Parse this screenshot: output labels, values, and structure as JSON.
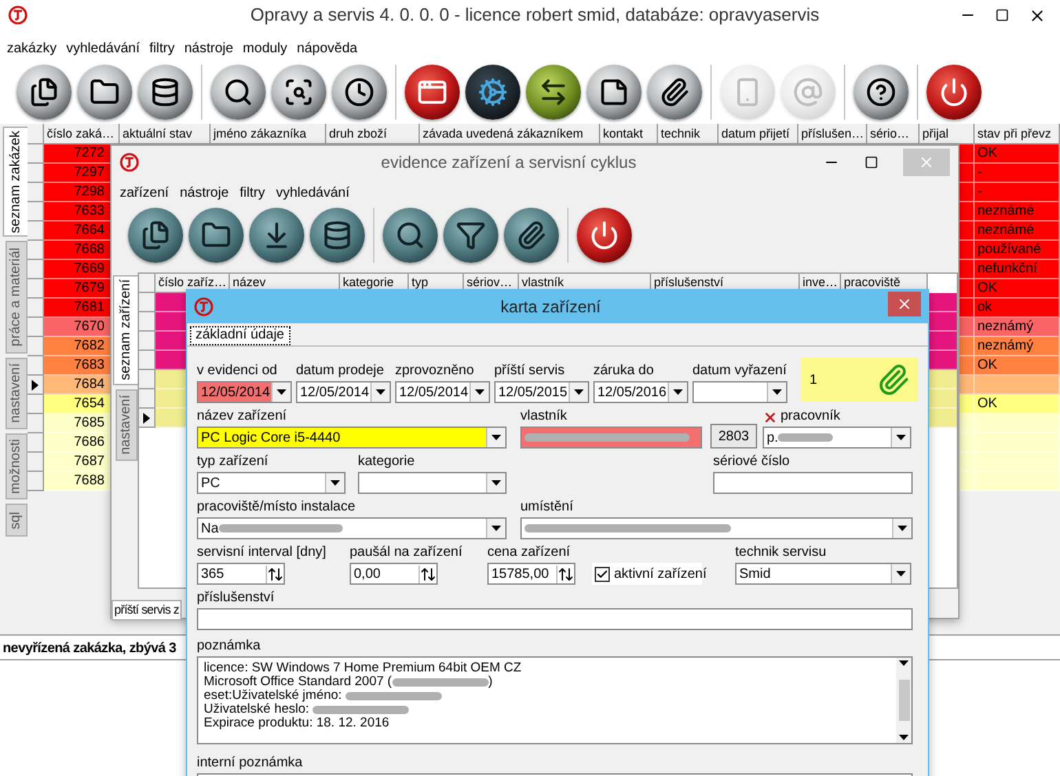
{
  "main_window": {
    "title": "Opravy a servis 4. 0. 0. 0 - licence robert smid, databáze: opravyaservis",
    "menu": [
      "zakázky",
      "vyhledávání",
      "filtry",
      "nástroje",
      "moduly",
      "nápověda"
    ],
    "toolbar_groups": [
      [
        {
          "kind": "dark",
          "disabled": false
        },
        {
          "kind": "dark",
          "disabled": false
        },
        {
          "kind": "dark",
          "disabled": false
        }
      ],
      [
        {
          "kind": "dark",
          "disabled": false
        },
        {
          "kind": "dark",
          "disabled": false
        },
        {
          "kind": "dark",
          "disabled": false
        }
      ],
      [
        {
          "kind": "red",
          "disabled": false
        },
        {
          "kind": "blue",
          "disabled": false
        },
        {
          "kind": "green",
          "disabled": false
        },
        {
          "kind": "dark",
          "disabled": false
        },
        {
          "kind": "dark",
          "disabled": false
        }
      ],
      [
        {
          "kind": "dark",
          "disabled": true
        },
        {
          "kind": "dark",
          "disabled": true
        }
      ],
      [
        {
          "kind": "dark",
          "disabled": false
        }
      ],
      [
        {
          "kind": "red",
          "disabled": false
        }
      ]
    ],
    "side_tabs": [
      {
        "label": "seznam zakázek",
        "selected": true
      },
      {
        "label": "práce a materiál",
        "selected": false
      },
      {
        "label": "nastavení",
        "selected": false
      },
      {
        "label": "možnosti",
        "selected": false
      },
      {
        "label": "sql",
        "selected": false
      }
    ],
    "table": {
      "columns": [
        "číslo zaká…",
        "aktuální stav",
        "jméno zákazníka",
        "druh zboží",
        "závada uvedená zákazníkem",
        "kontakt",
        "technik",
        "datum přijetí",
        "příslušen…",
        "sério…",
        "přijal",
        "stav při převz"
      ],
      "rows": [
        {
          "number": "7272",
          "intake_state": "OK",
          "color": "#ff0000",
          "selected": false
        },
        {
          "number": "7297",
          "intake_state": "-",
          "color": "#ff0000",
          "selected": false
        },
        {
          "number": "7298",
          "intake_state": "-",
          "color": "#ff0000",
          "selected": false
        },
        {
          "number": "7633",
          "intake_state": "neznámé",
          "color": "#ff0000",
          "selected": false
        },
        {
          "number": "7664",
          "intake_state": "neznámé",
          "color": "#ff0000",
          "selected": false
        },
        {
          "number": "7668",
          "intake_state": "používané",
          "color": "#ff0000",
          "selected": false
        },
        {
          "number": "7669",
          "intake_state": "nefunkční",
          "color": "#ff0000",
          "selected": false
        },
        {
          "number": "7679",
          "intake_state": "OK",
          "color": "#ff0000",
          "selected": false
        },
        {
          "number": "7681",
          "intake_state": "ok",
          "color": "#ff0000",
          "selected": false
        },
        {
          "number": "7670",
          "intake_state": "neznámý",
          "color": "#fa6464",
          "selected": false
        },
        {
          "number": "7682",
          "intake_state": "neznámý",
          "color": "#ff8040",
          "selected": false
        },
        {
          "number": "7683",
          "intake_state": "OK",
          "color": "#ff8040",
          "selected": false
        },
        {
          "number": "7684",
          "color": "#ffb878",
          "selected": true
        },
        {
          "number": "7654",
          "intake_state": "OK",
          "color": "#ffff80",
          "selected": false
        },
        {
          "number": "7685",
          "color": "#ffffc8",
          "selected": false
        },
        {
          "number": "7686",
          "color": "#ffffc8",
          "selected": false
        },
        {
          "number": "7687",
          "color": "#ffffc8",
          "selected": false
        },
        {
          "number": "7688",
          "color": "#ffffc8",
          "selected": false
        }
      ]
    },
    "status_bar": "nevyřízená zakázka, zbývá 3"
  },
  "devices_window": {
    "title": "evidence zařízení a servisní cyklus",
    "menu": [
      "zařízení",
      "nástroje",
      "filtry",
      "vyhledávání"
    ],
    "toolbar_groups": [
      [
        {
          "kind": "teal",
          "disabled": false
        },
        {
          "kind": "teal",
          "disabled": false
        },
        {
          "kind": "teal",
          "disabled": false
        },
        {
          "kind": "teal",
          "disabled": false
        }
      ],
      [
        {
          "kind": "teal",
          "disabled": false
        },
        {
          "kind": "teal",
          "disabled": false
        },
        {
          "kind": "teal",
          "disabled": false
        }
      ],
      [
        {
          "kind": "red",
          "disabled": false
        }
      ]
    ],
    "side_tabs": [
      {
        "label": "seznam zařízení",
        "selected": true
      },
      {
        "label": "nastavení",
        "selected": false
      }
    ],
    "table": {
      "columns": [
        "číslo zaříz…",
        "název",
        "kategorie",
        "typ",
        "sériov…",
        "vlastník",
        "příslušenství",
        "inve…",
        "pracoviště"
      ],
      "rows": [
        {
          "color": "#e6157d",
          "selected": false
        },
        {
          "color": "#e6157d",
          "selected": false
        },
        {
          "color": "#e6157d",
          "selected": false
        },
        {
          "color": "#e6157d",
          "selected": false
        },
        {
          "color": "#f0ec90",
          "selected": false
        },
        {
          "color": "#f0ec90",
          "selected": false
        },
        {
          "color": "#f0ec90",
          "selected": true
        }
      ]
    },
    "bottom_tab": "příští servis z"
  },
  "card": {
    "title": "karta zařízení",
    "tabs": [
      {
        "label": "základní údaje",
        "selected": true
      }
    ],
    "dates": [
      {
        "label": "v evidenci od",
        "value": "12/05/2014",
        "highlighted": true
      },
      {
        "label": "datum prodeje",
        "value": "12/05/2014",
        "highlighted": false
      },
      {
        "label": "zprovozněno",
        "value": "12/05/2014",
        "highlighted": false
      },
      {
        "label": "příští servis",
        "value": "12/05/2015",
        "highlighted": false
      },
      {
        "label": "záruka do",
        "value": "12/05/2016",
        "highlighted": false
      },
      {
        "label": "datum vyřazení",
        "highlighted": false
      }
    ],
    "attachments": {
      "count": "1"
    },
    "device_name": {
      "label": "název zařízení",
      "value": "PC Logic Core i5-4440"
    },
    "owner": {
      "label": "vlastník",
      "redacted": true
    },
    "owner_button": "2803",
    "worker": {
      "label": "pracovník",
      "value": "p.",
      "redacted": true
    },
    "device_type": {
      "label": "typ zařízení",
      "value": "PC"
    },
    "category": {
      "label": "kategorie"
    },
    "serial_number": {
      "label": "sériové číslo"
    },
    "workplace": {
      "label": "pracoviště/místo instalace",
      "value": "Na",
      "redacted": true
    },
    "location": {
      "label": "umístění",
      "redacted": true
    },
    "service_interval": {
      "label": "servisní interval [dny]",
      "value": "365"
    },
    "flat_fee": {
      "label": "paušál na zařízení",
      "value": "0,00"
    },
    "price": {
      "label": "cena zařízení",
      "value": "15785,00"
    },
    "active": {
      "label": "aktivní zařízení",
      "checked": true
    },
    "technician": {
      "label": "technik servisu",
      "value": "Smid"
    },
    "accessories": {
      "label": "příslušenství"
    },
    "note": {
      "label": "poznámka",
      "lines": [
        {
          "text": "licence: SW Windows 7 Home Premium 64bit OEM CZ",
          "redacted": false
        },
        {
          "text": "Microsoft Office Standard 2007 (",
          "redacted": true,
          "tail": ")"
        },
        {
          "text": "eset:Uživatelské jméno: ",
          "redacted": true
        },
        {
          "text": "Uživatelské heslo: ",
          "redacted": true
        },
        {
          "text": "Expirace produktu: 18. 12. 2016",
          "redacted": false
        }
      ]
    },
    "internal_note": {
      "label": "interní poznámka"
    }
  }
}
